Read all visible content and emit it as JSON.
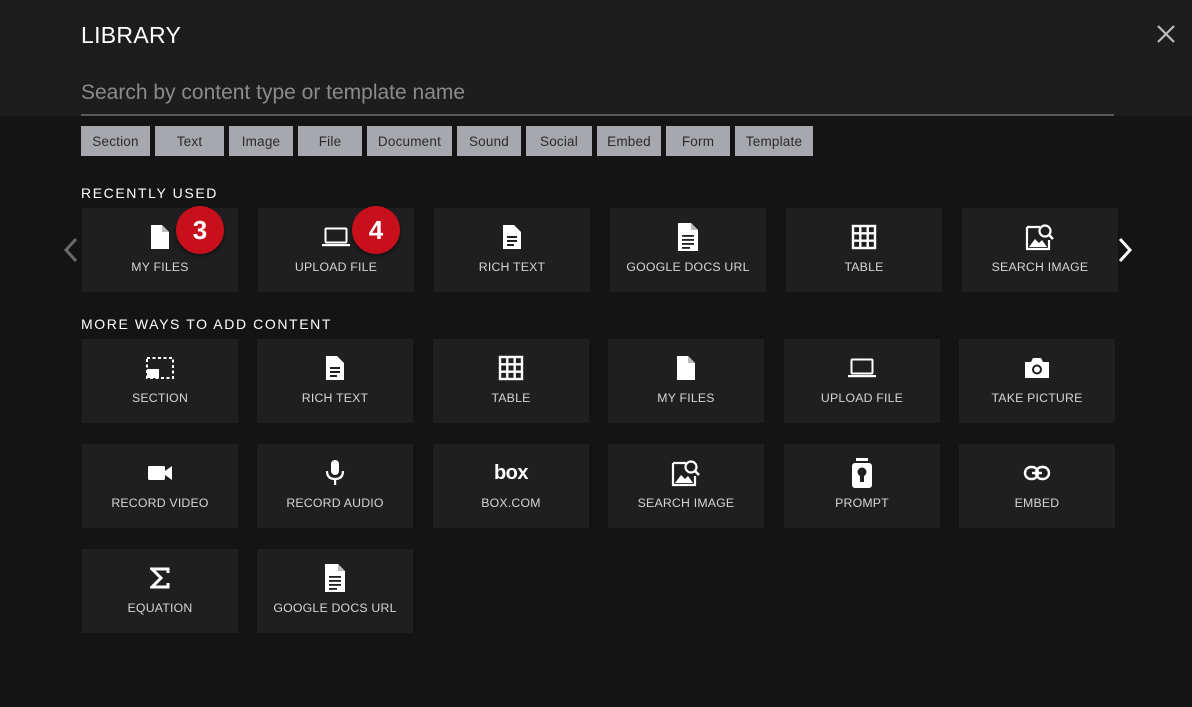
{
  "dialog": {
    "title": "LIBRARY",
    "close_icon": "close-icon"
  },
  "search": {
    "placeholder": "Search by content type or template name",
    "value": ""
  },
  "filters": [
    "Section",
    "Text",
    "Image",
    "File",
    "Document",
    "Sound",
    "Social",
    "Embed",
    "Form",
    "Template"
  ],
  "recently_used": {
    "heading": "RECENTLY USED",
    "items": [
      {
        "label": "MY FILES",
        "icon": "file-icon",
        "badge": "3"
      },
      {
        "label": "UPLOAD FILE",
        "icon": "laptop-icon",
        "badge": "4"
      },
      {
        "label": "RICH TEXT",
        "icon": "document-icon"
      },
      {
        "label": "GOOGLE DOCS URL",
        "icon": "google-doc-icon"
      },
      {
        "label": "TABLE",
        "icon": "table-icon"
      },
      {
        "label": "SEARCH IMAGE",
        "icon": "image-search-icon"
      }
    ],
    "prev_icon": "chevron-left-icon",
    "next_icon": "chevron-right-icon"
  },
  "more_ways": {
    "heading": "MORE WAYS TO ADD CONTENT",
    "items": [
      {
        "label": "SECTION",
        "icon": "section-icon"
      },
      {
        "label": "RICH TEXT",
        "icon": "document-icon"
      },
      {
        "label": "TABLE",
        "icon": "table-icon"
      },
      {
        "label": "MY FILES",
        "icon": "file-icon"
      },
      {
        "label": "UPLOAD FILE",
        "icon": "laptop-icon"
      },
      {
        "label": "TAKE PICTURE",
        "icon": "camera-icon"
      },
      {
        "label": "RECORD VIDEO",
        "icon": "video-camera-icon"
      },
      {
        "label": "RECORD AUDIO",
        "icon": "microphone-icon"
      },
      {
        "label": "BOX.COM",
        "icon": "box-logo-icon",
        "logo_text": "box"
      },
      {
        "label": "SEARCH IMAGE",
        "icon": "image-search-icon"
      },
      {
        "label": "PROMPT",
        "icon": "prompt-icon"
      },
      {
        "label": "EMBED",
        "icon": "link-icon"
      },
      {
        "label": "EQUATION",
        "icon": "sigma-icon"
      },
      {
        "label": "GOOGLE DOCS URL",
        "icon": "google-doc-icon"
      }
    ]
  },
  "colors": {
    "background": "#141414",
    "header": "#1d1d1d",
    "tile": "#1f1f20",
    "chip": "#a6a8ad",
    "badge": "#c8101d"
  }
}
